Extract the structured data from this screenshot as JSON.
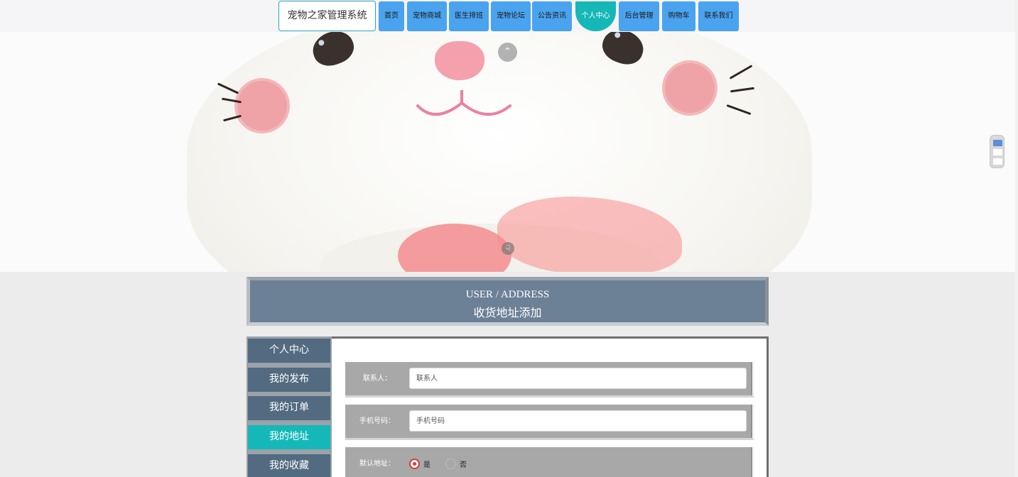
{
  "brand": "宠物之家管理系统",
  "nav": [
    {
      "label": "首页"
    },
    {
      "label": "宠物商城"
    },
    {
      "label": "医生排班"
    },
    {
      "label": "宠物论坛"
    },
    {
      "label": "公告资讯"
    },
    {
      "label": "个人中心",
      "active": true
    },
    {
      "label": "后台管理"
    },
    {
      "label": "购物车"
    },
    {
      "label": "联系我们"
    }
  ],
  "heading": {
    "en": "USER / ADDRESS",
    "cn": "收货地址添加"
  },
  "menu": [
    {
      "label": "个人中心"
    },
    {
      "label": "我的发布"
    },
    {
      "label": "我的订单"
    },
    {
      "label": "我的地址",
      "active": true
    },
    {
      "label": "我的收藏"
    }
  ],
  "form": {
    "contact": {
      "label": "联系人：",
      "placeholder": "联系人",
      "value": ""
    },
    "phone": {
      "label": "手机号码：",
      "placeholder": "手机号码",
      "value": ""
    },
    "default_address": {
      "label": "默认地址：",
      "options": [
        "是",
        "否"
      ],
      "selected": "是"
    }
  },
  "colors": {
    "nav": "#4aa3ef",
    "nav_active": "#16b7b7",
    "menu": "#536b80",
    "menu_active": "#15b8b8",
    "heading_bg": "#6c8096",
    "radio_selected": "#e03434"
  },
  "icons": {
    "scroll_top": "chevron-up-icon",
    "cursor": "hand-pointer-icon",
    "side_widget": "page-indicator-icon"
  }
}
